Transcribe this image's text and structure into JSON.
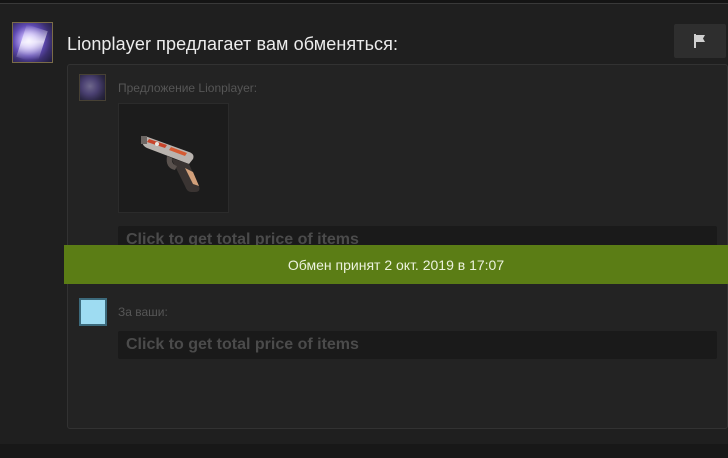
{
  "header": {
    "title": "Lionplayer предлагает вам обменяться:",
    "report_icon": "flag-icon"
  },
  "their_offer": {
    "label": "Предложение Lionplayer:",
    "item_icon": "pistol-weapon-skin",
    "price_prompt": "Click to get total price of items"
  },
  "status": {
    "banner_text": "Обмен принят 2 окт. 2019 в 17:07",
    "banner_color": "#5b7d15"
  },
  "your_offer": {
    "label": "За ваши:",
    "price_prompt": "Click to get total price of items",
    "avatar_color": "#9edcf2"
  }
}
